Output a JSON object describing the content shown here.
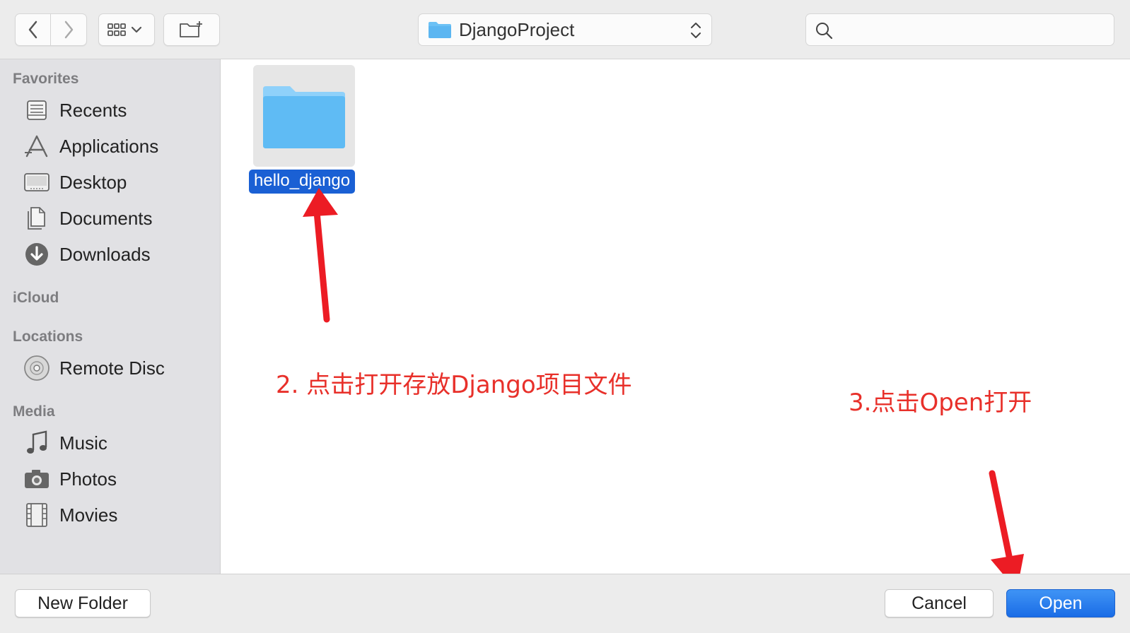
{
  "toolbar": {
    "back_icon": "chevron-left-icon",
    "forward_icon": "chevron-right-icon",
    "view_icon": "icon-grid-view-icon",
    "new_folder_icon": "folder-plus-icon",
    "path_popup": {
      "label": "DjangoProject",
      "icon": "folder-icon"
    },
    "search": {
      "placeholder": "",
      "value": ""
    }
  },
  "sidebar": {
    "sections": [
      {
        "header": "Favorites",
        "items": [
          {
            "label": "Recents",
            "icon": "recents-icon"
          },
          {
            "label": "Applications",
            "icon": "applications-icon"
          },
          {
            "label": "Desktop",
            "icon": "desktop-icon"
          },
          {
            "label": "Documents",
            "icon": "documents-icon"
          },
          {
            "label": "Downloads",
            "icon": "downloads-icon"
          }
        ]
      },
      {
        "header": "iCloud",
        "items": []
      },
      {
        "header": "Locations",
        "items": [
          {
            "label": "Remote Disc",
            "icon": "remote-disc-icon"
          }
        ]
      },
      {
        "header": "Media",
        "items": [
          {
            "label": "Music",
            "icon": "music-icon"
          },
          {
            "label": "Photos",
            "icon": "photos-icon"
          },
          {
            "label": "Movies",
            "icon": "movies-icon"
          }
        ]
      }
    ]
  },
  "content": {
    "files": [
      {
        "name": "hello_django",
        "selected": true,
        "icon": "folder-icon"
      }
    ]
  },
  "annotations": {
    "step2": "2. 点击打开存放Django项目文件",
    "step3": "3.点击Open打开",
    "color": "#e8302a"
  },
  "bottom": {
    "new_folder_label": "New Folder",
    "cancel_label": "Cancel",
    "open_label": "Open"
  },
  "colors": {
    "accent": "#1a60d4",
    "folder": "#6cc1f5"
  }
}
